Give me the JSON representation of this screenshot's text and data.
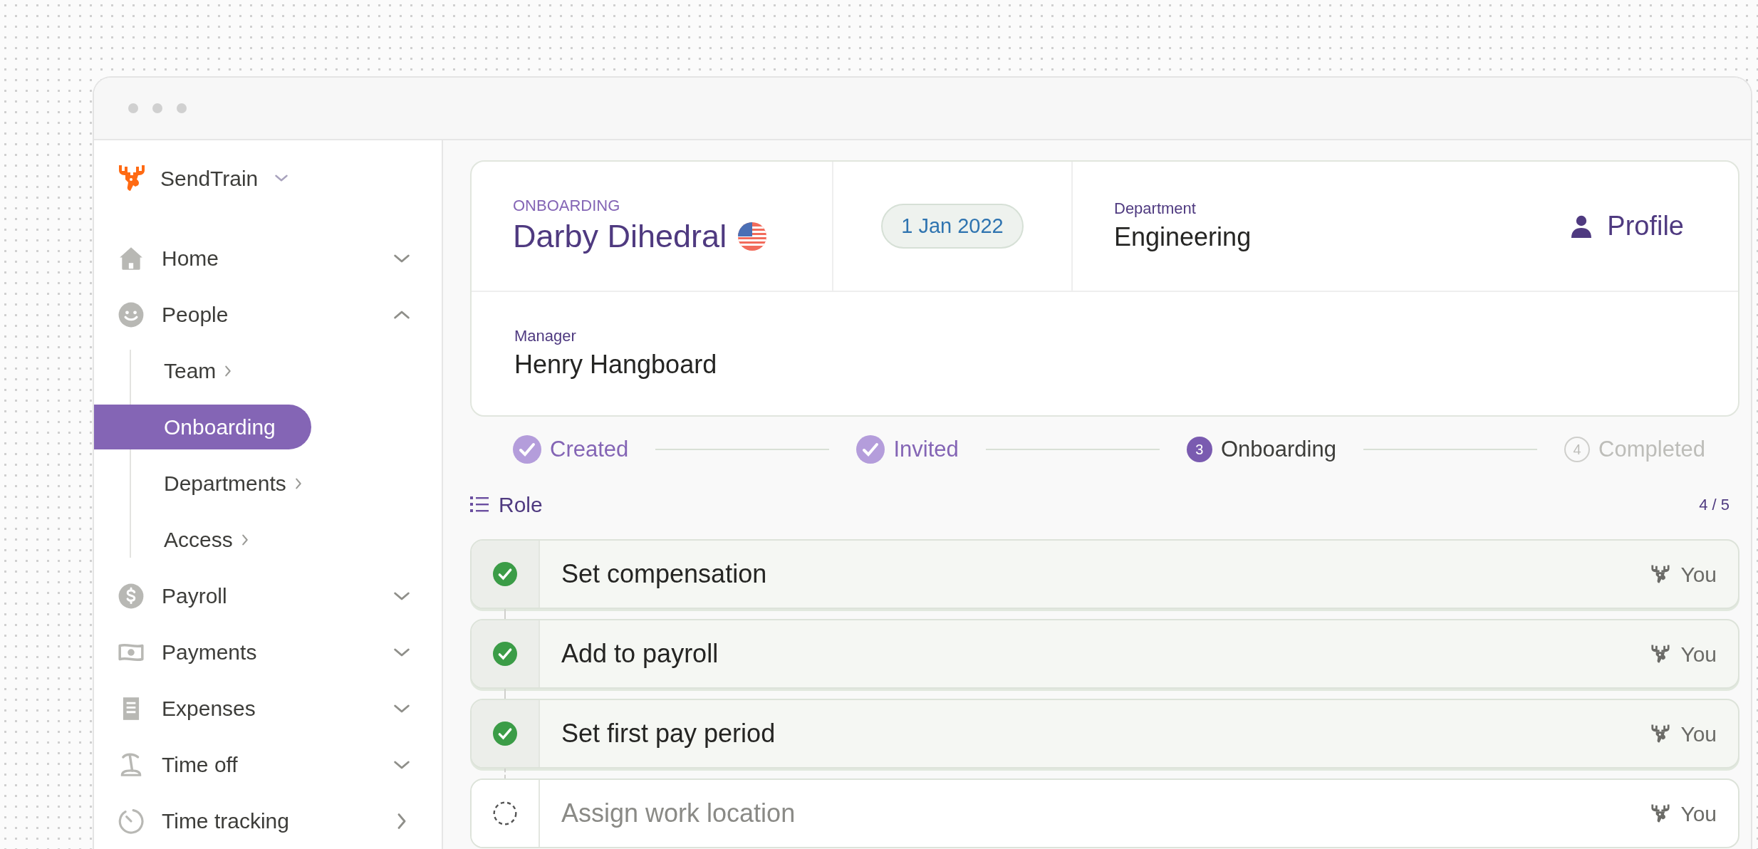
{
  "sidebar": {
    "brand": "SendTrain",
    "items": [
      {
        "label": "Home",
        "kind": "group",
        "expanded": false
      },
      {
        "label": "People",
        "kind": "group",
        "expanded": true,
        "children": [
          {
            "label": "Team",
            "selected": false
          },
          {
            "label": "Onboarding",
            "selected": true
          },
          {
            "label": "Departments",
            "selected": false
          },
          {
            "label": "Access",
            "selected": false
          }
        ]
      },
      {
        "label": "Payroll",
        "kind": "group",
        "expanded": false
      },
      {
        "label": "Payments",
        "kind": "group",
        "expanded": false
      },
      {
        "label": "Expenses",
        "kind": "group",
        "expanded": false
      },
      {
        "label": "Time off",
        "kind": "group",
        "expanded": false
      },
      {
        "label": "Time tracking",
        "kind": "link"
      }
    ]
  },
  "header": {
    "status": "ONBOARDING",
    "name": "Darby Dihedral",
    "date": "1 Jan 2022",
    "department_label": "Department",
    "department": "Engineering",
    "profile": "Profile",
    "manager_label": "Manager",
    "manager": "Henry Hangboard"
  },
  "steps": [
    {
      "label": "Created",
      "done": true
    },
    {
      "label": "Invited",
      "done": true
    },
    {
      "label": "Onboarding",
      "number": "3",
      "done": false,
      "current": true
    },
    {
      "label": "Completed",
      "number": "4",
      "done": false,
      "current": false
    }
  ],
  "checklist": {
    "title": "Role",
    "count": "4 / 5",
    "tasks": [
      {
        "label": "Set compensation",
        "done": true,
        "assignee": "You"
      },
      {
        "label": "Add to payroll",
        "done": true,
        "assignee": "You"
      },
      {
        "label": "Set first pay period",
        "done": true,
        "assignee": "You"
      },
      {
        "label": "Assign work location",
        "done": false,
        "assignee": "You"
      }
    ]
  }
}
